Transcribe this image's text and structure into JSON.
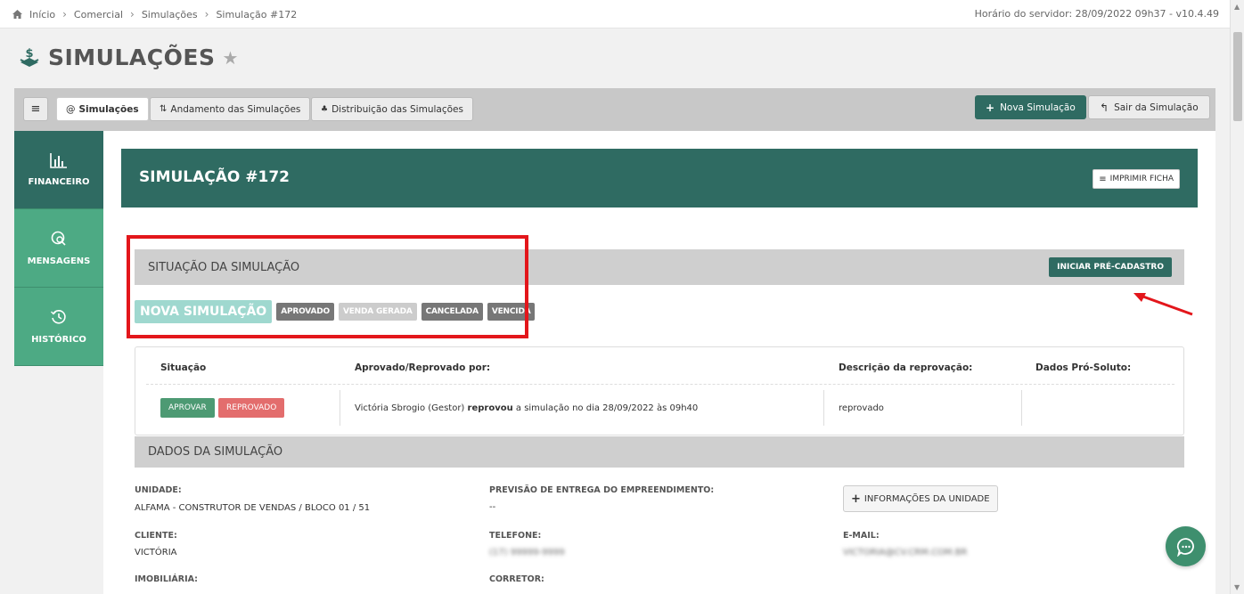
{
  "breadcrumb": {
    "items": [
      "Início",
      "Comercial",
      "Simulações",
      "Simulação #172"
    ]
  },
  "server_time": "Horário do servidor: 28/09/2022 09h37 - v10.4.49",
  "page": {
    "title": "SIMULAÇÕES"
  },
  "tabs": {
    "items": [
      {
        "label": "Simulações",
        "prefix": "@"
      },
      {
        "label": "Andamento das Simulações"
      },
      {
        "label": "Distribuição das Simulações"
      }
    ],
    "new_label": "Nova Simulação",
    "exit_label": "Sair da Simulação"
  },
  "sidenav": {
    "items": [
      {
        "label": "FINANCEIRO",
        "icon": "bar-chart-icon"
      },
      {
        "label": "MENSAGENS",
        "icon": "chat-search-icon"
      },
      {
        "label": "HISTÓRICO",
        "icon": "history-icon"
      }
    ]
  },
  "header": {
    "title": "SIMULAÇÃO #172",
    "print_label": "IMPRIMIR FICHA"
  },
  "situacao": {
    "title": "SITUAÇÃO DA SIMULAÇÃO",
    "iniciar_label": "INICIAR PRÉ-CADASTRO",
    "badges": {
      "main": "NOVA SIMULAÇÃO",
      "aprovado": "APROVADO",
      "venda_gerada": "VENDA GERADA",
      "cancelada": "CANCELADA",
      "vencida": "VENCIDA"
    }
  },
  "status_table": {
    "headers": {
      "situacao": "Situação",
      "aprovado_por": "Aprovado/Reprovado por:",
      "descricao": "Descrição da reprovação:",
      "dados": "Dados Pró-Soluto:"
    },
    "aprovar_label": "APROVAR",
    "reprovado_label": "REPROVADO",
    "row": {
      "user": "Victória Sbrogio (Gestor)",
      "action": "reprovou",
      "rest": "a simulação no dia 28/09/2022 às 09h40",
      "descricao": "reprovado"
    }
  },
  "dados": {
    "title": "DADOS DA SIMULAÇÃO",
    "unidade_label": "UNIDADE:",
    "unidade_value": "ALFAMA - CONSTRUTOR DE VENDAS / BLOCO 01 / 51",
    "previsao_label": "PREVISÃO DE ENTREGA DO EMPREENDIMENTO:",
    "previsao_value": "--",
    "info_label": "INFORMAÇÕES DA UNIDADE",
    "cliente_label": "CLIENTE:",
    "cliente_value": "VICTÓRIA",
    "telefone_label": "TELEFONE:",
    "telefone_value": "(17) 99999-9999",
    "email_label": "E-MAIL:",
    "email_value": "VICTORIA@CV.CRM.COM.BR",
    "imobiliaria_label": "IMOBILIÁRIA:",
    "corretor_label": "CORRETOR:"
  },
  "colors": {
    "primary": "#2f6b62",
    "side_green": "#4daa84",
    "highlight": "#e3161b",
    "badge_main": "#9fd8cf"
  }
}
